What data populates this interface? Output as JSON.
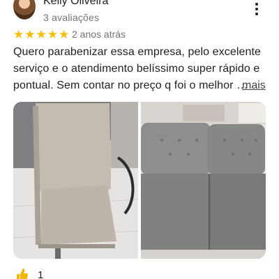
{
  "review": {
    "author_name": "Kelly Oliveira",
    "author_review_count": "3 avaliações",
    "rating": 5,
    "stars": [
      "★",
      "★",
      "★",
      "★",
      "★"
    ],
    "date": "2 anos atrás",
    "text_lines": [
      "Quero parabenizar essa empresa, pelo excelente",
      "serviço e o atendimento belíssimo super rápido e",
      "pontual. Sem contar no preço q foi o melhor …"
    ],
    "more_label": "mais",
    "like_count": "1"
  },
  "icons": {
    "menu": "more-vert-icon",
    "like": "thumb-up-icon",
    "star": "star-icon"
  },
  "colors": {
    "star": "#fbbc04",
    "secondary_text": "#70757a",
    "like_icon": "#f4b400"
  }
}
